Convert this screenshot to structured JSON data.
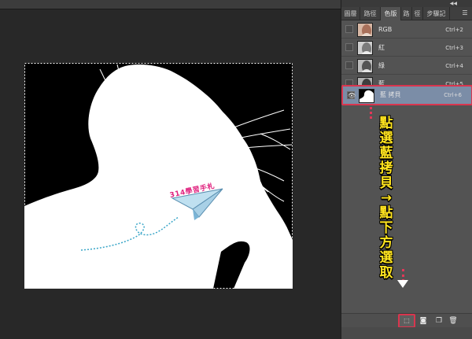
{
  "panel": {
    "tabs": [
      {
        "label": "圖層"
      },
      {
        "label": "路徑"
      },
      {
        "label": "色版"
      },
      {
        "label": "路"
      },
      {
        "label": "徑"
      },
      {
        "label": "步驟記"
      }
    ],
    "active_tab": "色版",
    "menu_icon": "panel-menu-icon",
    "collapse_icon": "collapse-arrows-icon"
  },
  "channels": [
    {
      "name": "RGB",
      "shortcut": "Ctrl+2",
      "visible": false,
      "selected": false
    },
    {
      "name": "紅",
      "shortcut": "Ctrl+3",
      "visible": false,
      "selected": false
    },
    {
      "name": "綠",
      "shortcut": "Ctrl+4",
      "visible": false,
      "selected": false
    },
    {
      "name": "藍",
      "shortcut": "Ctrl+5",
      "visible": false,
      "selected": false
    },
    {
      "name": "藍 拷貝",
      "shortcut": "Ctrl+6",
      "visible": true,
      "selected": true
    }
  ],
  "canvas": {
    "watermark": "314學習手札"
  },
  "annotation": {
    "text": "點選藍拷貝→點下方選取",
    "color": "#ffe41f",
    "highlight_color": "#d9354e"
  },
  "bottom_bar": {
    "buttons": [
      {
        "name": "load-channel-as-selection",
        "icon": "dotted-selection-icon"
      },
      {
        "name": "save-selection-as-channel",
        "icon": "mask-icon"
      },
      {
        "name": "new-channel",
        "icon": "new-page-icon"
      },
      {
        "name": "delete-channel",
        "icon": "trash-icon"
      }
    ]
  }
}
